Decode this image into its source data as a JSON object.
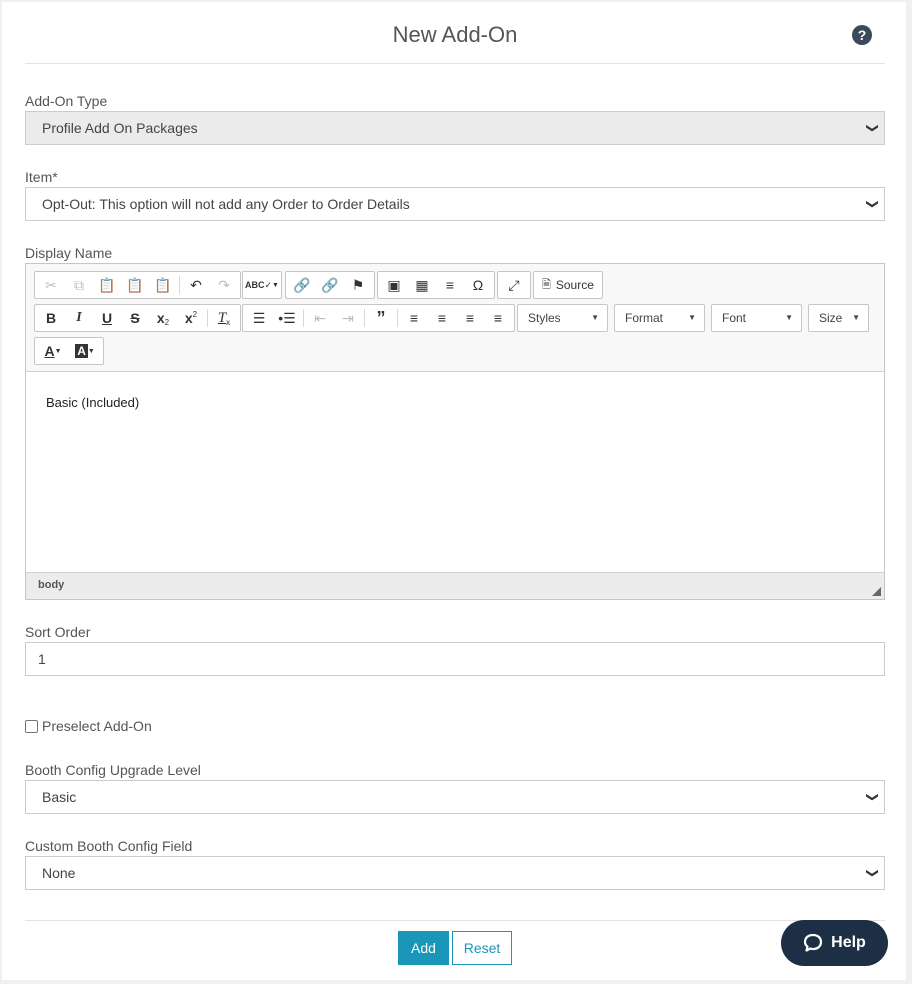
{
  "header": {
    "title": "New Add-On",
    "help_icon": "?"
  },
  "fields": {
    "addon_type": {
      "label": "Add-On Type",
      "value": "Profile Add On Packages"
    },
    "item": {
      "label": "Item*",
      "value": "Opt-Out: This option will not add any Order to Order Details"
    },
    "display_name": {
      "label": "Display Name"
    },
    "sort_order": {
      "label": "Sort Order",
      "value": "1"
    },
    "preselect": {
      "label": "Preselect Add-On",
      "checked": false
    },
    "booth_level": {
      "label": "Booth Config Upgrade Level",
      "value": "Basic"
    },
    "custom_field": {
      "label": "Custom Booth Config Field",
      "value": "None"
    }
  },
  "editor": {
    "content": "Basic (Included)",
    "path": "body",
    "toolbar": {
      "source_label": "Source",
      "styles_label": "Styles",
      "format_label": "Format",
      "font_label": "Font",
      "size_label": "Size",
      "bold": "B",
      "italic": "I",
      "underline": "U",
      "strike": "S",
      "omega": "Ω"
    }
  },
  "actions": {
    "add_label": "Add",
    "reset_label": "Reset"
  },
  "help_widget": {
    "label": "Help"
  },
  "colors": {
    "primary": "#1a96b8",
    "help_bg": "#1c2f45",
    "select_gray": "#ebebeb"
  }
}
